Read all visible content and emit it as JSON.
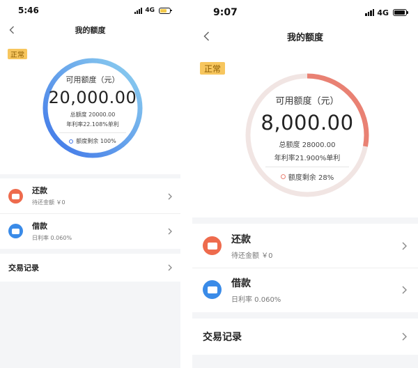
{
  "screens": [
    {
      "status": {
        "time": "5:46",
        "network": "4G"
      },
      "nav": {
        "title": "我的额度"
      },
      "badge": "正常",
      "credit": {
        "label": "可用额度（元）",
        "amount": "20,000.00",
        "total": "总额度 20000.00",
        "rate": "年利率22.108%单利",
        "remaining": "额度剩余 100%",
        "remaining_fraction": 1.0
      },
      "items": [
        {
          "title": "还款",
          "subtitle": "待还金额 ￥0"
        },
        {
          "title": "借款",
          "subtitle": "日利率 0.060%"
        }
      ],
      "records": "交易记录",
      "colors": {
        "ring_start": "#3e74e8",
        "ring_end": "#8fd2ef",
        "repay_icon": "#ee6b4d",
        "borrow_icon": "#3a8be8"
      }
    },
    {
      "status": {
        "time": "9:07",
        "network": "4G"
      },
      "nav": {
        "title": "我的额度"
      },
      "badge": "正常",
      "credit": {
        "label": "可用额度（元）",
        "amount": "8,000.00",
        "total": "总额度 28000.00",
        "rate": "年利率21.900%单利",
        "remaining": "额度剩余 28%",
        "remaining_fraction": 0.28
      },
      "items": [
        {
          "title": "还款",
          "subtitle": "待还金额 ￥0"
        },
        {
          "title": "借款",
          "subtitle": "日利率 0.060%"
        }
      ],
      "records": "交易记录",
      "colors": {
        "ring_track": "#f1e5e3",
        "ring_fill": "#e98173",
        "repay_icon": "#ee6b4d",
        "borrow_icon": "#3a8be8"
      }
    }
  ]
}
